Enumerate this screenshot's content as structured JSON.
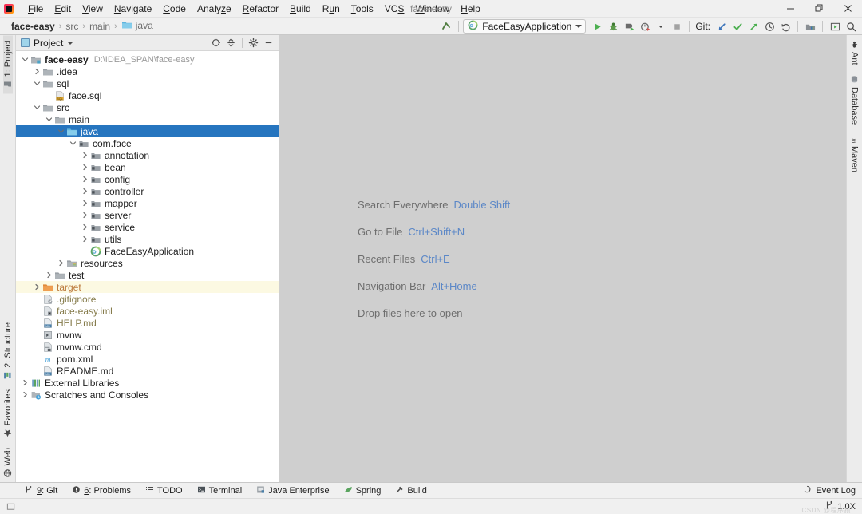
{
  "window": {
    "title": "face-easy",
    "controls": {
      "minimize": "minimize-icon",
      "restore": "restore-icon",
      "close": "close-icon"
    }
  },
  "menubar": {
    "items": [
      {
        "label": "File",
        "mnemonic": "F"
      },
      {
        "label": "Edit",
        "mnemonic": "E"
      },
      {
        "label": "View",
        "mnemonic": "V"
      },
      {
        "label": "Navigate",
        "mnemonic": "N"
      },
      {
        "label": "Code",
        "mnemonic": "C"
      },
      {
        "label": "Analyze",
        "mnemonic": "z"
      },
      {
        "label": "Refactor",
        "mnemonic": "R"
      },
      {
        "label": "Build",
        "mnemonic": "B"
      },
      {
        "label": "Run",
        "mnemonic": "u"
      },
      {
        "label": "Tools",
        "mnemonic": "T"
      },
      {
        "label": "VCS",
        "mnemonic": "S"
      },
      {
        "label": "Window",
        "mnemonic": "W"
      },
      {
        "label": "Help",
        "mnemonic": "H"
      }
    ]
  },
  "navbar": {
    "breadcrumbs": [
      {
        "label": "face-easy",
        "bold": true,
        "icon": null
      },
      {
        "label": "src",
        "bold": false,
        "icon": null
      },
      {
        "label": "main",
        "bold": false,
        "icon": null
      },
      {
        "label": "java",
        "bold": false,
        "icon": "folder-blue-icon"
      }
    ],
    "separator": "›"
  },
  "toolbar": {
    "back_icon": "back-arrow-icon",
    "run_config": {
      "name": "FaceEasyApplication",
      "icon": "spring-boot-icon",
      "dropdown_icon": "chevron-down-icon"
    },
    "buttons": [
      {
        "name": "run-button",
        "icon": "play-icon",
        "color": "#3c9f40"
      },
      {
        "name": "debug-button",
        "icon": "debug-bug-icon",
        "color": "#4a8a3c"
      },
      {
        "name": "run-with-coverage",
        "icon": "coverage-icon",
        "color": "#3f7f3f"
      },
      {
        "name": "profile-button",
        "icon": "profiler-icon",
        "color": "#6b6b6b"
      },
      {
        "name": "stop-button",
        "icon": "stop-square-icon",
        "color": "#9a9a9a"
      }
    ],
    "git": {
      "label": "Git:",
      "actions": [
        {
          "name": "update-project-button",
          "icon": "update-arrow-icon",
          "color": "#3b73b9"
        },
        {
          "name": "commit-button",
          "icon": "checkmark-icon",
          "color": "#3c9f40"
        },
        {
          "name": "push-button",
          "icon": "push-arrow-icon",
          "color": "#3c9f40"
        },
        {
          "name": "history-button",
          "icon": "clock-icon",
          "color": "#555555"
        },
        {
          "name": "rollback-button",
          "icon": "undo-icon",
          "color": "#555555"
        }
      ]
    },
    "right_actions": [
      {
        "name": "project-structure-button",
        "icon": "project-structure-icon"
      },
      {
        "name": "select-run-config-button",
        "icon": "run-config-icon"
      },
      {
        "name": "search-button",
        "icon": "search-icon"
      }
    ]
  },
  "left_stripe": {
    "top": [
      {
        "label": "1: Project",
        "icon": "project-folder-icon",
        "active": true
      }
    ],
    "bottom": [
      {
        "label": "2: Structure",
        "icon": "structure-icon",
        "active": false
      },
      {
        "label": "Favorites",
        "icon": "star-icon",
        "active": false
      },
      {
        "label": "Web",
        "icon": "web-icon",
        "active": false
      }
    ]
  },
  "right_stripe": {
    "top": [
      {
        "label": "Ant",
        "icon": "ant-icon"
      },
      {
        "label": "Database",
        "icon": "database-icon"
      },
      {
        "label": "Maven",
        "icon": "maven-icon"
      }
    ]
  },
  "project_panel": {
    "title": "Project",
    "title_icon": "project-view-icon",
    "dropdown_icon": "chevron-down-icon",
    "actions": [
      {
        "name": "scroll-from-source-button",
        "icon": "target-crosshair-icon"
      },
      {
        "name": "collapse-all-button",
        "icon": "collapse-all-icon"
      },
      {
        "name": "settings-button",
        "icon": "gear-icon"
      },
      {
        "name": "hide-button",
        "icon": "minimize-dash-icon"
      }
    ],
    "tree": [
      {
        "label": "face-easy",
        "sub": "D:\\IDEA_SPAN\\face-easy",
        "indent": 0,
        "arrow": "expanded",
        "icon": "module-icon",
        "bold": true,
        "state": "normal"
      },
      {
        "label": ".idea",
        "indent": 1,
        "arrow": "collapsed",
        "icon": "folder-grey-icon",
        "state": "normal"
      },
      {
        "label": "sql",
        "indent": 1,
        "arrow": "expanded",
        "icon": "folder-grey-icon",
        "state": "normal"
      },
      {
        "label": "face.sql",
        "indent": 2,
        "arrow": "none",
        "icon": "sql-file-icon",
        "state": "normal"
      },
      {
        "label": "src",
        "indent": 1,
        "arrow": "expanded",
        "icon": "folder-grey-icon",
        "state": "normal"
      },
      {
        "label": "main",
        "indent": 2,
        "arrow": "expanded",
        "icon": "folder-grey-icon",
        "state": "normal"
      },
      {
        "label": "java",
        "indent": 3,
        "arrow": "expanded",
        "icon": "folder-blue-icon",
        "state": "selected"
      },
      {
        "label": "com.face",
        "indent": 4,
        "arrow": "expanded",
        "icon": "package-icon",
        "state": "normal"
      },
      {
        "label": "annotation",
        "indent": 5,
        "arrow": "collapsed",
        "icon": "package-icon",
        "state": "normal"
      },
      {
        "label": "bean",
        "indent": 5,
        "arrow": "collapsed",
        "icon": "package-icon",
        "state": "normal"
      },
      {
        "label": "config",
        "indent": 5,
        "arrow": "collapsed",
        "icon": "package-icon",
        "state": "normal"
      },
      {
        "label": "controller",
        "indent": 5,
        "arrow": "collapsed",
        "icon": "package-icon",
        "state": "normal"
      },
      {
        "label": "mapper",
        "indent": 5,
        "arrow": "collapsed",
        "icon": "package-icon",
        "state": "normal"
      },
      {
        "label": "server",
        "indent": 5,
        "arrow": "collapsed",
        "icon": "package-icon",
        "state": "normal"
      },
      {
        "label": "service",
        "indent": 5,
        "arrow": "collapsed",
        "icon": "package-icon",
        "state": "normal"
      },
      {
        "label": "utils",
        "indent": 5,
        "arrow": "collapsed",
        "icon": "package-icon",
        "state": "normal"
      },
      {
        "label": "FaceEasyApplication",
        "indent": 5,
        "arrow": "none",
        "icon": "spring-boot-icon",
        "state": "normal"
      },
      {
        "label": "resources",
        "indent": 3,
        "arrow": "collapsed",
        "icon": "resources-icon",
        "state": "normal"
      },
      {
        "label": "test",
        "indent": 2,
        "arrow": "collapsed",
        "icon": "folder-grey-icon",
        "state": "normal"
      },
      {
        "label": "target",
        "indent": 1,
        "arrow": "collapsed",
        "icon": "folder-orange-icon",
        "state": "excluded"
      },
      {
        "label": ".gitignore",
        "indent": 1,
        "arrow": "none",
        "icon": "gitignore-icon",
        "state": "ignored"
      },
      {
        "label": "face-easy.iml",
        "indent": 1,
        "arrow": "none",
        "icon": "iml-file-icon",
        "state": "ignored"
      },
      {
        "label": "HELP.md",
        "indent": 1,
        "arrow": "none",
        "icon": "markdown-icon",
        "state": "ignored"
      },
      {
        "label": "mvnw",
        "indent": 1,
        "arrow": "none",
        "icon": "script-file-icon",
        "state": "normal"
      },
      {
        "label": "mvnw.cmd",
        "indent": 1,
        "arrow": "none",
        "icon": "cmd-file-icon",
        "state": "normal"
      },
      {
        "label": "pom.xml",
        "indent": 1,
        "arrow": "none",
        "icon": "maven-pom-icon",
        "state": "normal"
      },
      {
        "label": "README.md",
        "indent": 1,
        "arrow": "none",
        "icon": "markdown-icon",
        "state": "normal"
      },
      {
        "label": "External Libraries",
        "indent": 0,
        "arrow": "collapsed",
        "icon": "libraries-icon",
        "state": "normal"
      },
      {
        "label": "Scratches and Consoles",
        "indent": 0,
        "arrow": "collapsed",
        "icon": "scratches-icon",
        "state": "normal"
      }
    ]
  },
  "editor": {
    "empty_hints": [
      {
        "name": "Search Everywhere",
        "key": "Double Shift"
      },
      {
        "name": "Go to File",
        "key": "Ctrl+Shift+N"
      },
      {
        "name": "Recent Files",
        "key": "Ctrl+E"
      },
      {
        "name": "Navigation Bar",
        "key": "Alt+Home"
      }
    ],
    "drop_text": "Drop files here to open"
  },
  "tool_windows": {
    "items": [
      {
        "label": "Git",
        "num": "9",
        "icon": "git-branch-icon"
      },
      {
        "label": "Problems",
        "num": "6",
        "icon": "problems-icon"
      },
      {
        "label": "TODO",
        "num": "",
        "icon": "todo-list-icon"
      },
      {
        "label": "Terminal",
        "num": "",
        "icon": "terminal-icon"
      },
      {
        "label": "Java Enterprise",
        "num": "",
        "icon": "java-enterprise-icon"
      },
      {
        "label": "Spring",
        "num": "",
        "icon": "spring-leaf-icon"
      },
      {
        "label": "Build",
        "num": "",
        "icon": "build-hammer-icon"
      }
    ],
    "event_log": {
      "label": "Event Log",
      "icon": "event-log-icon"
    }
  },
  "statusbar": {
    "left_icon": "no-message-icon",
    "right": {
      "branch_icon": "git-branch-icon",
      "zoom": "1.0X"
    },
    "watermark": "CSDN @程序猿"
  },
  "colors": {
    "selection_blue": "#2675bf",
    "excluded_highlight": "#fcf9e2",
    "excluded_text": "#bc7a3d",
    "ignored_text": "#867c4c",
    "hint_key_blue": "#5b87c7",
    "editor_bg": "#cfcfcf",
    "panel_bg": "#ffffff",
    "chrome_bg": "#f0f0f0"
  }
}
